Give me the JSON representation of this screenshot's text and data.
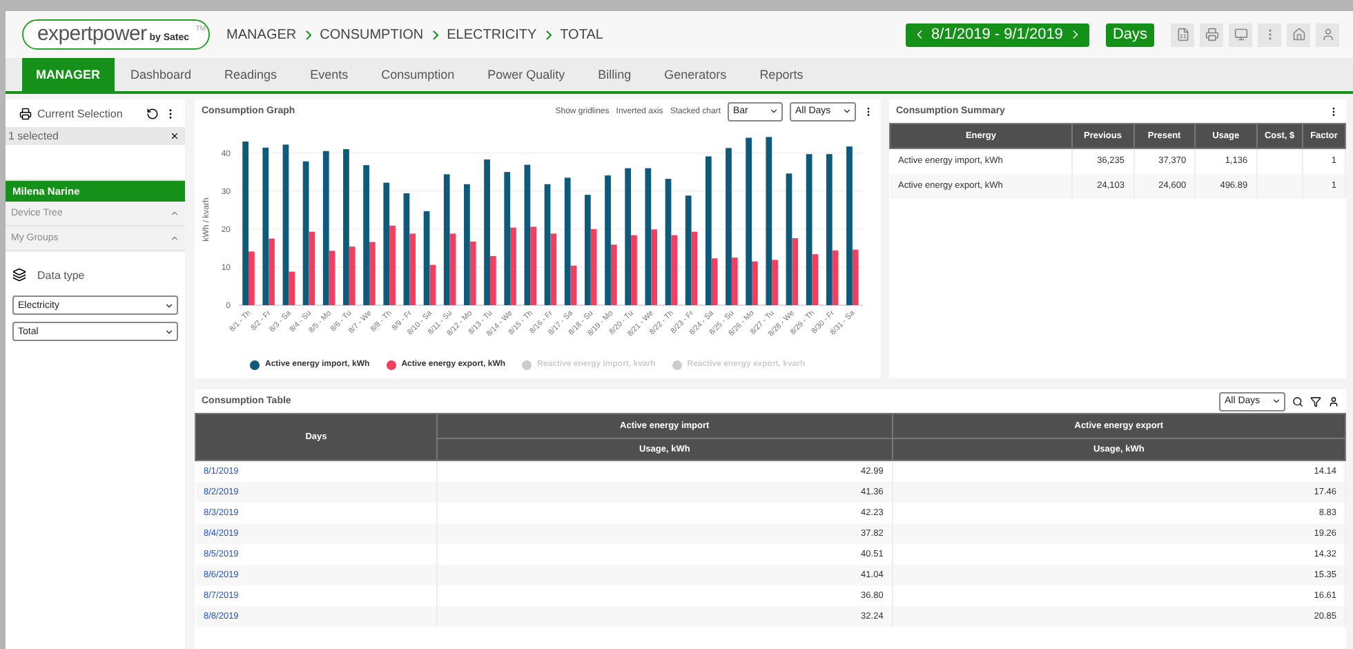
{
  "header": {
    "logo": {
      "main": "expertpower",
      "by": "by Satec",
      "tm": "TM"
    },
    "breadcrumb": [
      "MANAGER",
      "CONSUMPTION",
      "ELECTRICITY",
      "TOTAL"
    ],
    "date_range": "8/1/2019 - 9/1/2019",
    "period": "Days"
  },
  "tabs": [
    {
      "label": "MANAGER",
      "selected": true
    },
    {
      "label": "Dashboard",
      "selected": false
    },
    {
      "label": "Readings",
      "selected": false
    },
    {
      "label": "Events",
      "selected": false
    },
    {
      "label": "Consumption",
      "selected": false
    },
    {
      "label": "Power Quality",
      "selected": false
    },
    {
      "label": "Billing",
      "selected": false
    },
    {
      "label": "Generators",
      "selected": false
    },
    {
      "label": "Reports",
      "selected": false
    }
  ],
  "sidebar": {
    "title": "Current Selection",
    "selection_count": "1 selected",
    "selected_item": "Milena Narine",
    "sections": [
      {
        "label": "Device Tree",
        "expanded": false
      },
      {
        "label": "My Groups",
        "expanded": false
      }
    ],
    "data_type_label": "Data type",
    "data_type": "Electricity",
    "sub_type": "Total"
  },
  "graph": {
    "title": "Consumption Graph",
    "toggles": [
      "Show gridlines",
      "Inverted axis",
      "Stacked chart"
    ],
    "chart_type": "Bar",
    "range": "All Days",
    "legend_extra": [
      {
        "label": "Reactive energy import, kvarh",
        "enabled": false
      },
      {
        "label": "Reactive energy export, kvarh",
        "enabled": false
      }
    ],
    "chart_data": {
      "type": "bar",
      "grid": true,
      "ylabel": "kWh / kvarh",
      "ylim": [
        0,
        45
      ],
      "yticks": [
        0,
        10,
        20,
        30,
        40
      ],
      "categories": [
        "8/1 - Th",
        "8/2 - Fr",
        "8/3 - Sa",
        "8/4 - Su",
        "8/5 - Mo",
        "8/6 - Tu",
        "8/7 - We",
        "8/8 - Th",
        "8/9 - Fr",
        "8/10 - Sa",
        "8/11 - Su",
        "8/12 - Mo",
        "8/13 - Tu",
        "8/14 - We",
        "8/15 - Th",
        "8/16 - Fr",
        "8/17 - Sa",
        "8/18 - Su",
        "8/19 - Mo",
        "8/20 - Tu",
        "8/21 - We",
        "8/22 - Th",
        "8/23 - Fr",
        "8/24 - Sa",
        "8/25 - Su",
        "8/26 - Mo",
        "8/27 - Tu",
        "8/28 - We",
        "8/29 - Th",
        "8/30 - Fr",
        "8/31 - Sa"
      ],
      "series": [
        {
          "name": "Active energy import, kWh",
          "color": "#0d5a7a",
          "values": [
            43.0,
            41.4,
            42.2,
            37.8,
            40.5,
            41.0,
            36.8,
            32.2,
            29.4,
            24.7,
            34.4,
            31.8,
            38.3,
            35.0,
            36.9,
            31.8,
            33.5,
            29.0,
            34.1,
            36.0,
            36.0,
            33.2,
            28.8,
            39.1,
            41.3,
            44.0,
            44.2,
            34.6,
            39.7,
            39.7,
            41.7
          ]
        },
        {
          "name": "Active energy export, kWh",
          "color": "#f0405f",
          "values": [
            14.1,
            17.5,
            8.8,
            19.3,
            14.3,
            15.4,
            16.6,
            20.9,
            18.8,
            10.6,
            18.8,
            16.7,
            12.9,
            20.4,
            20.6,
            18.8,
            10.4,
            20.0,
            15.9,
            18.4,
            19.9,
            18.4,
            19.3,
            12.3,
            12.5,
            11.5,
            11.9,
            17.6,
            13.4,
            14.4,
            14.6
          ]
        }
      ]
    }
  },
  "summary": {
    "title": "Consumption Summary",
    "columns": [
      "Energy",
      "Previous",
      "Present",
      "Usage",
      "Cost, $",
      "Factor"
    ],
    "rows": [
      [
        "Active energy import, kWh",
        "36,235",
        "37,370",
        "1,136",
        "",
        "1"
      ],
      [
        "Active energy export, kWh",
        "24,103",
        "24,600",
        "496.89",
        "",
        "1"
      ]
    ]
  },
  "table": {
    "title": "Consumption Table",
    "range": "All Days",
    "columns": [
      "Days",
      "Active energy import",
      "Active energy export"
    ],
    "subcolumns": [
      "Usage, kWh",
      "Usage, kWh"
    ],
    "rows": [
      [
        "8/1/2019",
        "42.99",
        "14.14"
      ],
      [
        "8/2/2019",
        "41.36",
        "17.46"
      ],
      [
        "8/3/2019",
        "42.23",
        "8.83"
      ],
      [
        "8/4/2019",
        "37.82",
        "19.26"
      ],
      [
        "8/5/2019",
        "40.51",
        "14.32"
      ],
      [
        "8/6/2019",
        "41.04",
        "15.35"
      ],
      [
        "8/7/2019",
        "36.80",
        "16.61"
      ],
      [
        "8/8/2019",
        "32.24",
        "20.85"
      ]
    ]
  }
}
